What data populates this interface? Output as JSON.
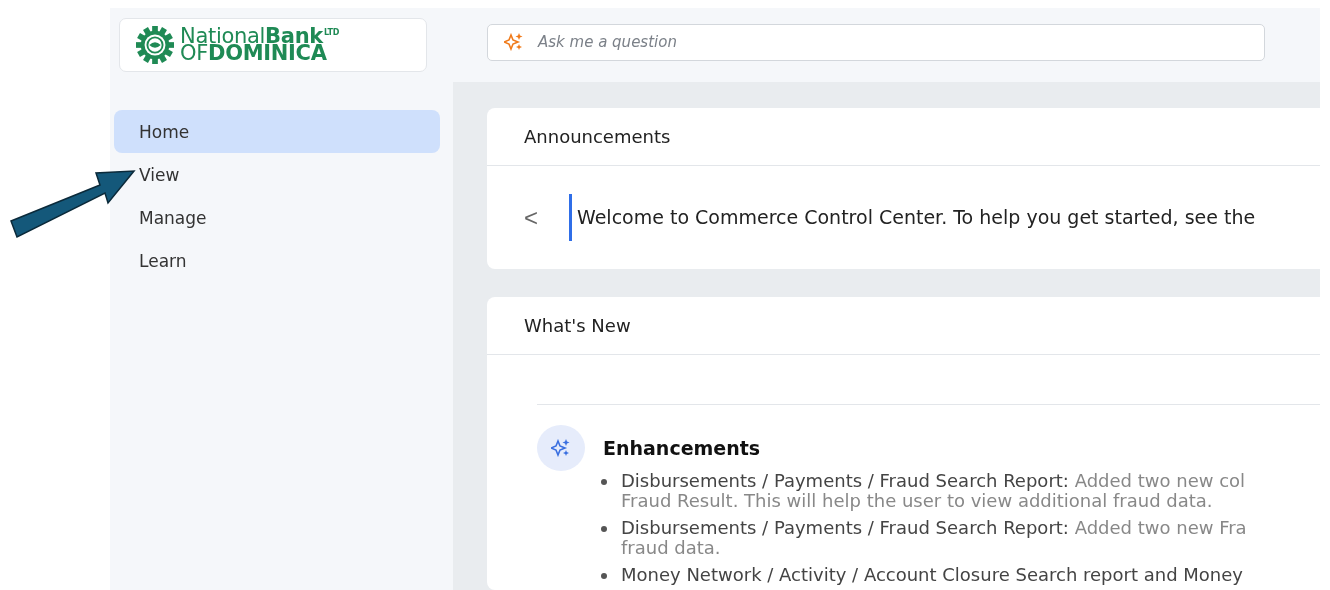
{
  "logo": {
    "line1": "National**Bank**",
    "suffix": "LTD",
    "line2": "OF**DOMINICA**"
  },
  "search": {
    "placeholder": "Ask me a question"
  },
  "sidebar": {
    "items": [
      {
        "label": "Home",
        "selected": true
      },
      {
        "label": "View",
        "selected": false
      },
      {
        "label": "Manage",
        "selected": false
      },
      {
        "label": "Learn",
        "selected": false
      }
    ]
  },
  "annotation": {
    "kind": "arrow"
  },
  "announcements": {
    "title": "Announcements",
    "prev": "<",
    "message": "Welcome to Commerce Control Center. To help you get started, see the"
  },
  "whats_new": {
    "title": "What's New",
    "section": "Enhancements",
    "items": [
      {
        "lead": "Disbursements / Payments / Fraud Search Report:",
        "rest": "Added two new col",
        "continuation": "Fraud Result. This will help the user to view additional fraud data."
      },
      {
        "lead": "Disbursements / Payments / Fraud Search Report:",
        "rest": "Added two new Fra",
        "continuation": "fraud data."
      },
      {
        "lead": "Money Network / Activity / Account Closure Search report and Money"
      }
    ]
  }
}
